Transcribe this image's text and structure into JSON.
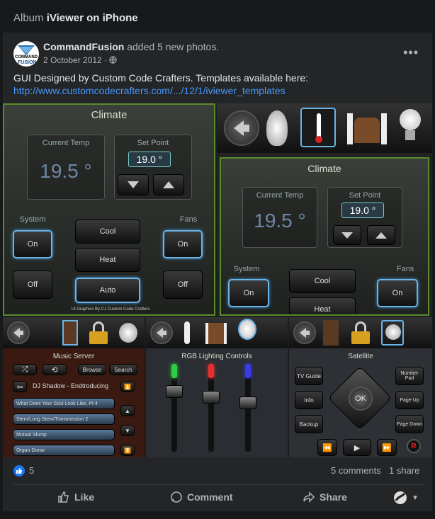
{
  "album": {
    "prefix": "Album",
    "title": "iViewer on iPhone"
  },
  "post": {
    "author": "CommandFusion",
    "action": "added 5 new photos.",
    "date": "2 October 2012",
    "privacy_icon": "globe-icon",
    "more_icon": "more-options-icon",
    "text": "GUI Designed by Custom Code Crafters. Templates available here:",
    "link": "http://www.customcodecrafters.com/.../12/1/iviewer_templates",
    "avatar_text": [
      "COMMAND",
      "FUSION"
    ]
  },
  "photo1": {
    "title": "Climate",
    "current_label": "Current Temp",
    "current_value": "19.5 °",
    "setpoint_label": "Set Point",
    "setpoint_value": "19.0 °",
    "system_label": "System",
    "fans_label": "Fans",
    "on": "On",
    "off": "Off",
    "cool": "Cool",
    "heat": "Heat",
    "auto": "Auto",
    "credit": "UI Graphics By CJ Custom Code Crafters"
  },
  "photo2": {
    "title": "Climate",
    "current_label": "Current Temp",
    "current_value": "19.5 °",
    "setpoint_label": "Set Point",
    "setpoint_value": "19.0 °",
    "system_label": "System",
    "fans_label": "Fans",
    "on": "On",
    "cool": "Cool",
    "heat": "Heat"
  },
  "photo3": {
    "title": "Music Server",
    "browse": "Browse",
    "search": "Search",
    "now_playing": "DJ Shadow - Endtroducing",
    "tracks": [
      "What Does Your Soul Look Like, Pt 4",
      "Stem/Long Stem/Transmission 2",
      "Mutual Slump",
      "Organ Donor"
    ]
  },
  "photo4": {
    "title": "RGB Lighting Controls",
    "colors": [
      "#2ecc40",
      "#e63030",
      "#3a3ae6"
    ]
  },
  "photo5": {
    "title": "Satellite",
    "tv_guide": "TV Guide",
    "info": "Info",
    "backup": "Backup",
    "number_pad": "Number Pad",
    "page_up": "Page Up",
    "page_down": "Page Down",
    "ok": "OK",
    "record": "R"
  },
  "stats": {
    "likes": "5",
    "comments": "5 comments",
    "shares": "1 share"
  },
  "actions": {
    "like": "Like",
    "comment": "Comment",
    "share": "Share"
  }
}
